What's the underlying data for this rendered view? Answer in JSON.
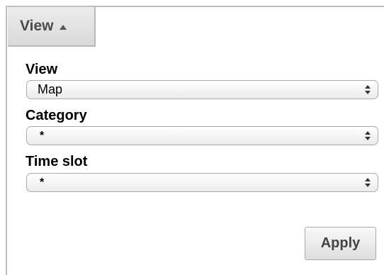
{
  "toggle": {
    "label": "View",
    "icon": "caret-up-icon"
  },
  "fields": {
    "view": {
      "label": "View",
      "value": "Map"
    },
    "category": {
      "label": "Category",
      "value": "*"
    },
    "time_slot": {
      "label": "Time slot",
      "value": "*"
    }
  },
  "actions": {
    "apply_label": "Apply"
  }
}
